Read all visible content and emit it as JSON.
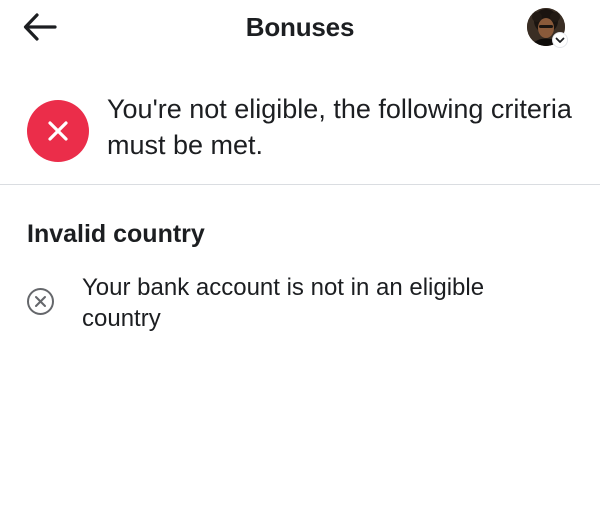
{
  "header": {
    "title": "Bonuses",
    "back_icon": "arrow-left-icon",
    "avatar_icon": "profile-avatar",
    "avatar_menu_icon": "chevron-down-icon"
  },
  "status": {
    "icon": "close-icon",
    "icon_color": "#eb2d4a",
    "message": "You're not eligible, the following criteria must be met."
  },
  "criteria_section": {
    "title": "Invalid country",
    "items": [
      {
        "icon": "circle-x-icon",
        "text": "Your bank account is not in an eligible country"
      }
    ]
  },
  "colors": {
    "text": "#1c1e21",
    "divider": "#dadde1",
    "error": "#eb2d4a"
  }
}
